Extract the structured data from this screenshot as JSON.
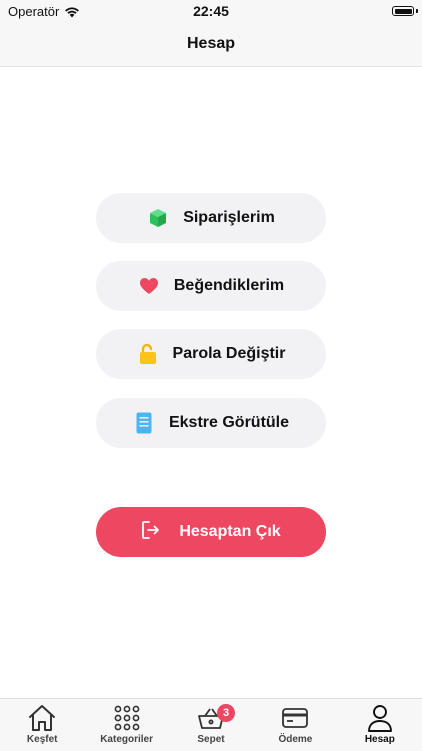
{
  "status_bar": {
    "carrier": "Operatör",
    "time": "22:45"
  },
  "nav": {
    "title": "Hesap"
  },
  "menu": {
    "orders": "Siparişlerim",
    "favorites": "Beğendiklerim",
    "password": "Parola Değiştir",
    "statement": "Ekstre Görütüle"
  },
  "logout": {
    "label": "Hesaptan Çık"
  },
  "tabs": [
    {
      "label": "Keşfet"
    },
    {
      "label": "Kategoriler"
    },
    {
      "label": "Sepet",
      "badge": "3"
    },
    {
      "label": "Ödeme"
    },
    {
      "label": "Hesap"
    }
  ],
  "colors": {
    "accent": "#ee4762",
    "button_bg": "#f2f2f5",
    "bar_bg": "#f7f7f8"
  },
  "icons": {
    "orders": "green-box-icon",
    "favorites": "heart-icon",
    "password": "unlock-icon",
    "statement": "document-icon",
    "logout": "logout-icon"
  }
}
